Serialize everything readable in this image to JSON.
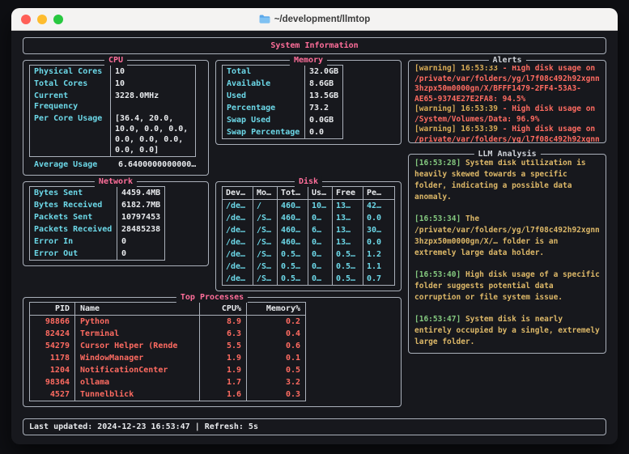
{
  "window": {
    "title": "~/development/llmtop"
  },
  "header": {
    "title": "System Information"
  },
  "cpu": {
    "title": "CPU",
    "rows": [
      {
        "label": "Physical Cores",
        "value": "10"
      },
      {
        "label": "Total Cores",
        "value": "10"
      },
      {
        "label": "Current Frequency",
        "value": "3228.0MHz"
      },
      {
        "label": "Per Core Usage",
        "value": "[36.4, 20.0, 10.0, 0.0, 0.0, 0.0, 0.0, 0.0, 0.0, 0.0]"
      }
    ],
    "footer": {
      "label": "Average Usage",
      "value": "6.6400000000000…"
    }
  },
  "memory": {
    "title": "Memory",
    "rows": [
      {
        "label": "Total",
        "value": "32.0GB"
      },
      {
        "label": "Available",
        "value": "8.6GB"
      },
      {
        "label": "Used",
        "value": "13.5GB"
      },
      {
        "label": "Percentage",
        "value": "73.2"
      },
      {
        "label": "Swap Used",
        "value": "0.0GB"
      },
      {
        "label": "Swap Percentage",
        "value": "0.0"
      }
    ]
  },
  "network": {
    "title": "Network",
    "rows": [
      {
        "label": "Bytes Sent",
        "value": "4459.4MB"
      },
      {
        "label": "Bytes Received",
        "value": "6182.7MB"
      },
      {
        "label": "Packets Sent",
        "value": "10797453"
      },
      {
        "label": "Packets Received",
        "value": "28485238"
      },
      {
        "label": "Error In",
        "value": "0"
      },
      {
        "label": "Error Out",
        "value": "0"
      }
    ]
  },
  "disk": {
    "title": "Disk",
    "headers": [
      "Dev…",
      "Mo…",
      "Tot…",
      "Us…",
      "Free",
      "Pe…"
    ],
    "rows": [
      [
        "/de…",
        "/",
        "460…",
        "10…",
        "13…",
        "42…"
      ],
      [
        "/de…",
        "/S…",
        "460…",
        "0…",
        "13…",
        "0.0"
      ],
      [
        "/de…",
        "/S…",
        "460…",
        "6…",
        "13…",
        "30…"
      ],
      [
        "/de…",
        "/S…",
        "460…",
        "0…",
        "13…",
        "0.0"
      ],
      [
        "/de…",
        "/S…",
        "0.5…",
        "0…",
        "0.5…",
        "1.2"
      ],
      [
        "/de…",
        "/S…",
        "0.5…",
        "0…",
        "0.5…",
        "1.1"
      ],
      [
        "/de…",
        "/S…",
        "0.5…",
        "0…",
        "0.5…",
        "0.7"
      ]
    ]
  },
  "processes": {
    "title": "Top Processes",
    "headers": [
      "PID",
      "Name",
      "CPU%",
      "Memory%"
    ],
    "rows": [
      [
        "98866",
        "Python",
        "8.9",
        "0.2"
      ],
      [
        "82424",
        "Terminal",
        "6.3",
        "0.4"
      ],
      [
        "54279",
        "Cursor Helper (Rende",
        "5.5",
        "0.6"
      ],
      [
        "1178",
        "WindowManager",
        "1.9",
        "0.1"
      ],
      [
        "1204",
        "NotificationCenter",
        "1.9",
        "0.5"
      ],
      [
        "98364",
        "ollama",
        "1.7",
        "3.2"
      ],
      [
        "4527",
        "Tunnelblick",
        "1.6",
        "0.3"
      ]
    ]
  },
  "alerts": {
    "title": "Alerts",
    "items": [
      {
        "level": "[warning]",
        "time": "16:53:33",
        "sep": "-",
        "message": "High disk usage on /private/var/folders/yg/l7f08c492h92xgnn3hzpx50m0000gn/X/BFFF1479-2FF4-53A3-AE65-9374E27E2FA8: 94.5%"
      },
      {
        "level": "[warning]",
        "time": "16:53:39",
        "sep": "-",
        "message": "High disk usage on /System/Volumes/Data: 96.9%"
      },
      {
        "level": "[warning]",
        "time": "16:53:39",
        "sep": "-",
        "message": "High disk usage on /private/var/folders/yg/l7f08c492h92xgnn"
      }
    ]
  },
  "llm": {
    "title": "LLM Analysis",
    "items": [
      {
        "time": "[16:53:28]",
        "text": "System disk utilization is heavily skewed towards a specific folder, indicating a possible data anomaly."
      },
      {
        "time": "[16:53:34]",
        "text": "The /private/var/folders/yg/l7f08c492h92xgnn3hzpx50m0000gn/X/… folder is an extremely large data holder."
      },
      {
        "time": "[16:53:40]",
        "text": "High disk usage of a specific folder suggests potential data corruption or file system issue."
      },
      {
        "time": "[16:53:47]",
        "text": "System disk is nearly entirely occupied by a single, extremely large folder."
      }
    ]
  },
  "status_bar": {
    "text": "Last updated: 2024-12-23 16:53:47 | Refresh: 5s"
  },
  "colors": {
    "accent_pink": "#ff6e9a",
    "cyan": "#6cd8e8",
    "red": "#ff6b61",
    "yellow": "#d9ac55",
    "green": "#84c97f",
    "white": "#e9ebee"
  }
}
